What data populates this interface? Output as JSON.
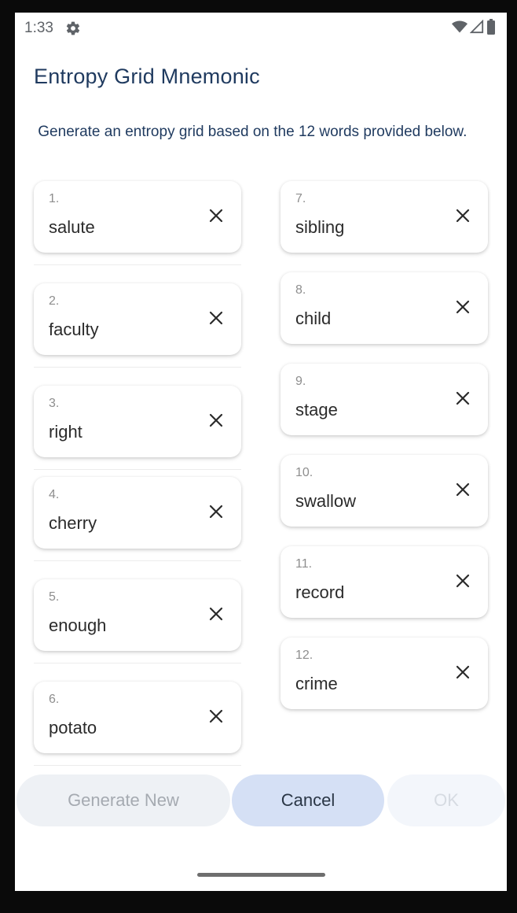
{
  "status_bar": {
    "time": "1:33",
    "icons": [
      "gear-icon",
      "wifi-icon",
      "signal-icon",
      "battery-icon"
    ]
  },
  "title": "Entropy Grid Mnemonic",
  "subtitle": " Generate an entropy grid based on the 12 words provided below.",
  "words": [
    {
      "num": "1.",
      "word": "salute"
    },
    {
      "num": "2.",
      "word": "faculty"
    },
    {
      "num": "3.",
      "word": "right"
    },
    {
      "num": "4.",
      "word": "cherry"
    },
    {
      "num": "5.",
      "word": "enough"
    },
    {
      "num": "6.",
      "word": "potato"
    },
    {
      "num": "7.",
      "word": "sibling"
    },
    {
      "num": "8.",
      "word": "child"
    },
    {
      "num": "9.",
      "word": "stage"
    },
    {
      "num": "10.",
      "word": "swallow"
    },
    {
      "num": "11.",
      "word": "record"
    },
    {
      "num": "12.",
      "word": "crime"
    }
  ],
  "buttons": {
    "generate_new": "Generate New",
    "cancel": "Cancel",
    "ok": "OK"
  },
  "colors": {
    "title": "#1f3a5f",
    "cancel_bg": "#d5e0f5",
    "generate_bg": "#eef1f5"
  }
}
